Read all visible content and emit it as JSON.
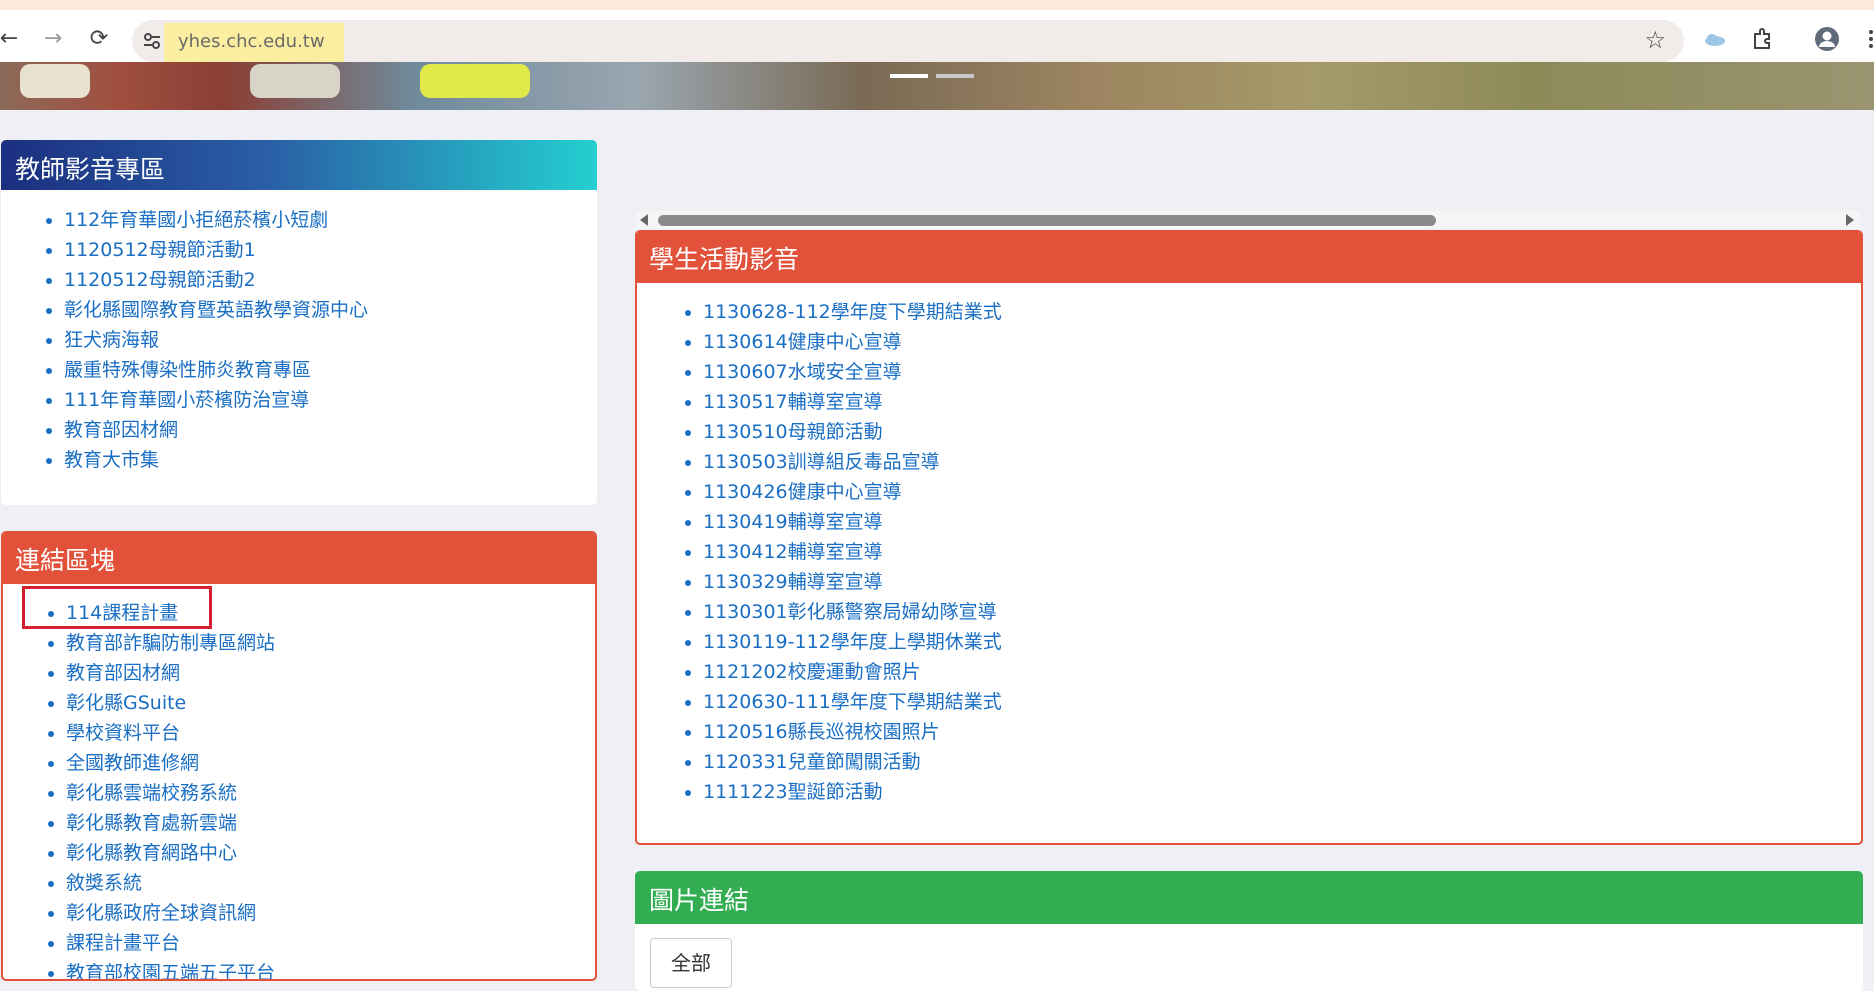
{
  "browser": {
    "url": "yhes.chc.edu.tw",
    "back_icon": "←",
    "forward_icon": "→",
    "reload_icon": "⟳",
    "star_icon": "☆"
  },
  "teacher_panel": {
    "title": "教師影音專區",
    "items": [
      "112年育華國小拒絕菸檳小短劇",
      "1120512母親節活動1",
      "1120512母親節活動2",
      "彰化縣國際教育暨英語教學資源中心",
      "狂犬病海報",
      "嚴重特殊傳染性肺炎教育專區",
      "111年育華國小菸檳防治宣導",
      "教育部因材網",
      "教育大市集"
    ]
  },
  "links_panel": {
    "title": "連結區塊",
    "items": [
      "114課程計畫",
      "教育部詐騙防制專區網站",
      "教育部因材網",
      "彰化縣GSuite",
      "學校資料平台",
      "全國教師進修網",
      "彰化縣雲端校務系統",
      "彰化縣教育處新雲端",
      "彰化縣教育網路中心",
      "敘獎系統",
      "彰化縣政府全球資訊網",
      "課程計畫平台",
      "教育部校園五端五子平台"
    ]
  },
  "student_panel": {
    "title": "學生活動影音",
    "items": [
      "1130628-112學年度下學期結業式",
      "1130614健康中心宣導",
      "1130607水域安全宣導",
      "1130517輔導室宣導",
      "1130510母親節活動",
      "1130503訓導組反毒品宣導",
      "1130426健康中心宣導",
      "1130419輔導室宣導",
      "1130412輔導室宣導",
      "1130329輔導室宣導",
      "1130301彰化縣警察局婦幼隊宣導",
      "1130119-112學年度上學期休業式",
      "1121202校慶運動會照片",
      "1120630-111學年度下學期結業式",
      "1120516縣長巡視校園照片",
      "1120331兒童節闖關活動",
      "1111223聖誕節活動"
    ]
  },
  "images_panel": {
    "title": "圖片連結",
    "all_button": "全部"
  },
  "colors": {
    "red_header": "#e2513a",
    "green_header": "#33ad52",
    "link": "#1a6fc4",
    "highlight_box": "#d41f2e"
  }
}
